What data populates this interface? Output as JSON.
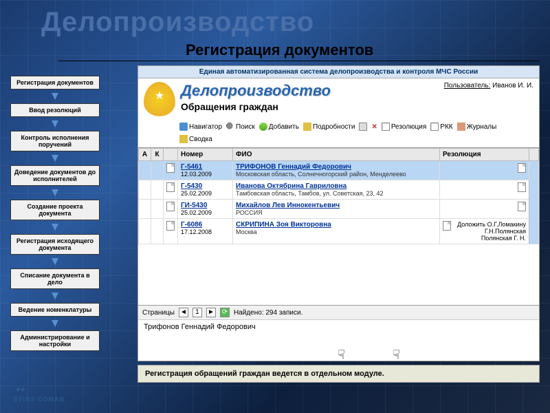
{
  "slide": {
    "main_title": "Делопроизводство",
    "sub_title": "Регистрация документов"
  },
  "sidebar": [
    "Регистрация документов",
    "Ввод резолюций",
    "Контроль исполнения поручений",
    "Доведение документов до исполнителей",
    "Создание проекта документа",
    "Регистрация исходящего документа",
    "Списание документа в дело",
    "Ведение номенклатуры",
    "Администрирование и настройки"
  ],
  "app": {
    "header": "Единая автоматизированная система делопроизводства и контроля МЧС России",
    "title": "Делопроизводство",
    "section": "Обращения граждан",
    "user_label": "Пользователь:",
    "user_name": "Иванов И. И."
  },
  "toolbar": {
    "nav": "Навигатор",
    "search": "Поиск",
    "add": "Добавить",
    "details": "Подробности",
    "del": "✕",
    "resolution": "Резолюция",
    "rkk": "РКК",
    "journals": "Журналы",
    "summary": "Сводка"
  },
  "columns": {
    "a": "А",
    "k": "К",
    "empty": "",
    "number": "Номер",
    "fio": "ФИО",
    "res": "Резолюция"
  },
  "rows": [
    {
      "num": "Г-5461",
      "date": "12.03.2009",
      "fio": "ТРИФОНОВ Геннадий Федорович",
      "addr": "Московская область, Солнечногорский район, Менделеево",
      "res": "",
      "selected": true
    },
    {
      "num": "Г-5430",
      "date": "25.02.2009",
      "fio": "Иванова Октябрина Гавриловна",
      "addr": "Тамбовская область, Тамбов, ул. Советская, 23, 42",
      "res": ""
    },
    {
      "num": "ГИ-5430",
      "date": "25.02.2009",
      "fio": "Михайлов Лев Иннокентьевич",
      "addr": "РОССИЯ",
      "res": ""
    },
    {
      "num": "Г-6086",
      "date": "17.12.2008",
      "fio": "СКРИПИНА Зоя Викторовна",
      "addr": "Москва",
      "res": "Доложить О.Г.Ломакину\nГ.Н.Полянская\nПолянская Г. Н."
    }
  ],
  "pager": {
    "pages_label": "Страницы",
    "page": "1",
    "found": "Найдено: 294 записи."
  },
  "detail": {
    "name": "Трифонов Геннадий Федорович"
  },
  "note": "Регистрация обращений граждан ведется в отдельном модуле.",
  "footer": "STINS COMAN"
}
